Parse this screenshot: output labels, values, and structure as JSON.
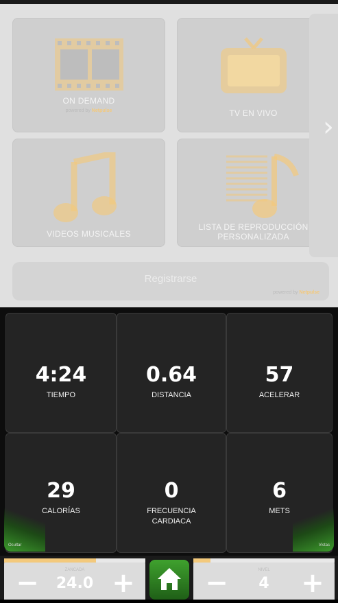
{
  "media": {
    "tiles": [
      {
        "label": "ON DEMAND",
        "powered_prefix": "powered by",
        "powered_brand": "Netpulse",
        "icon": "film-icon"
      },
      {
        "label": "TV EN VIVO",
        "icon": "tv-icon"
      },
      {
        "label": "VIDEOS MUSICALES",
        "icon": "music-note-icon"
      },
      {
        "label_line1": "LISTA DE REPRODUCCIÓN",
        "label_line2": "PERSONALIZADA",
        "icon": "playlist-icon"
      }
    ],
    "next_glyph": "›",
    "register": {
      "label": "Registrarse",
      "powered_prefix": "powered by",
      "powered_brand": "Netpulse"
    }
  },
  "stats": [
    {
      "value": "4:24",
      "label": "TIEMPO"
    },
    {
      "value": "0.64",
      "label": "DISTANCIA"
    },
    {
      "value": "57",
      "label": "ACELERAR"
    },
    {
      "value": "29",
      "label": "CALORÍAS"
    },
    {
      "value": "0",
      "label_line1": "FRECUENCIA",
      "label_line2": "CARDIACA"
    },
    {
      "value": "6",
      "label": "METS"
    }
  ],
  "corner_labels": {
    "left": "Ocultar",
    "right": "Vistas"
  },
  "controls": {
    "left": {
      "caption": "ZANCADA",
      "value": "24.0",
      "minus": "−",
      "plus": "+",
      "level_fraction": 0.65
    },
    "right": {
      "caption": "NIVEL",
      "value": "4",
      "minus": "−",
      "plus": "+",
      "level_fraction": 0.12
    },
    "home_icon": "home-icon"
  },
  "colors": {
    "accent": "#f3c97c",
    "green": "#3fa12e"
  }
}
